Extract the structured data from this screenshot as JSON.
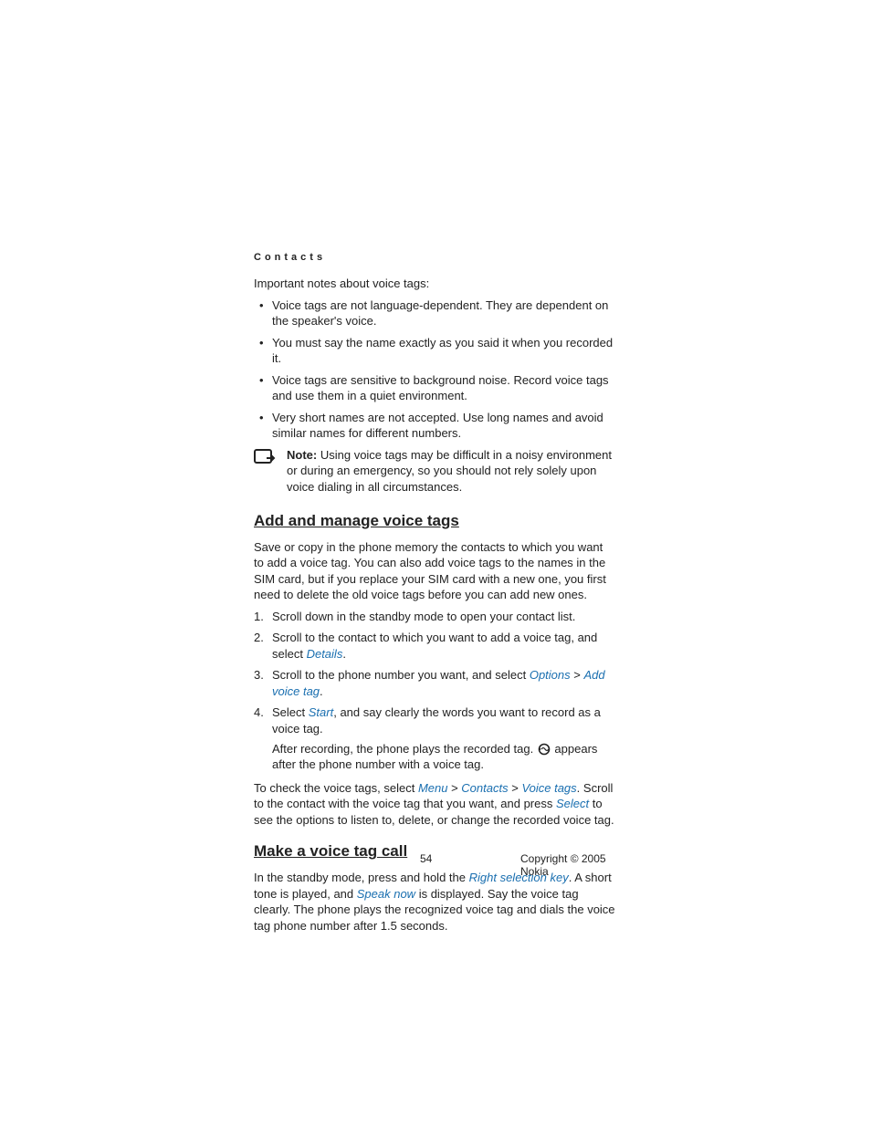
{
  "section_header": "Contacts",
  "intro": "Important notes about voice tags:",
  "bullets": [
    "Voice tags are not language-dependent. They are dependent on the speaker's voice.",
    "You must say the name exactly as you said it when you recorded it.",
    "Voice tags are sensitive to background noise. Record voice tags and use them in a quiet environment.",
    "Very short names are not accepted. Use long names and avoid similar names for different numbers."
  ],
  "note": {
    "label": "Note:",
    "text": "Using voice tags may be difficult in a noisy environment or during an emergency, so you should not rely solely upon voice dialing in all circumstances."
  },
  "h2_add": "Add and manage voice tags",
  "add_intro": "Save or copy in the phone memory the contacts to which you want to add a voice tag. You can also add voice tags to the names in the SIM card, but if you replace your SIM card with a new one, you first need to delete the old voice tags before you can add new ones.",
  "steps": {
    "s1": "Scroll down in the standby mode to open your contact list.",
    "s2a": "Scroll to the contact to which you want to add a voice tag, and select ",
    "s2_link": "Details",
    "s2b": ".",
    "s3a": "Scroll to the phone number you want, and select ",
    "s3_link1": "Options",
    "s3_sep": " > ",
    "s3_link2": "Add voice tag",
    "s3b": ".",
    "s4a": "Select ",
    "s4_link": "Start",
    "s4b": ", and say clearly the words you want to record as a voice tag.",
    "s4_sub_a": "After recording, the phone plays the recorded tag. ",
    "s4_sub_b": " appears after the phone number with a voice tag."
  },
  "check": {
    "a": "To check the voice tags, select ",
    "menu": "Menu",
    "sep": " > ",
    "contacts": "Contacts",
    "voice_tags": "Voice tags",
    "b": ". Scroll to the contact with the voice tag that you want, and press ",
    "select": "Select",
    "c": " to see the options to listen to, delete, or change the recorded voice tag."
  },
  "h2_call": "Make a voice tag call",
  "call": {
    "a": "In the standby mode, press and hold the ",
    "rsk": "Right selection key",
    "b": ". A short tone is played, and ",
    "speak": "Speak now",
    "c": " is displayed. Say the voice tag clearly. The phone plays the recognized voice tag and dials the voice tag phone number after 1.5 seconds."
  },
  "footer": {
    "page": "54",
    "copyright": "Copyright © 2005 Nokia"
  }
}
